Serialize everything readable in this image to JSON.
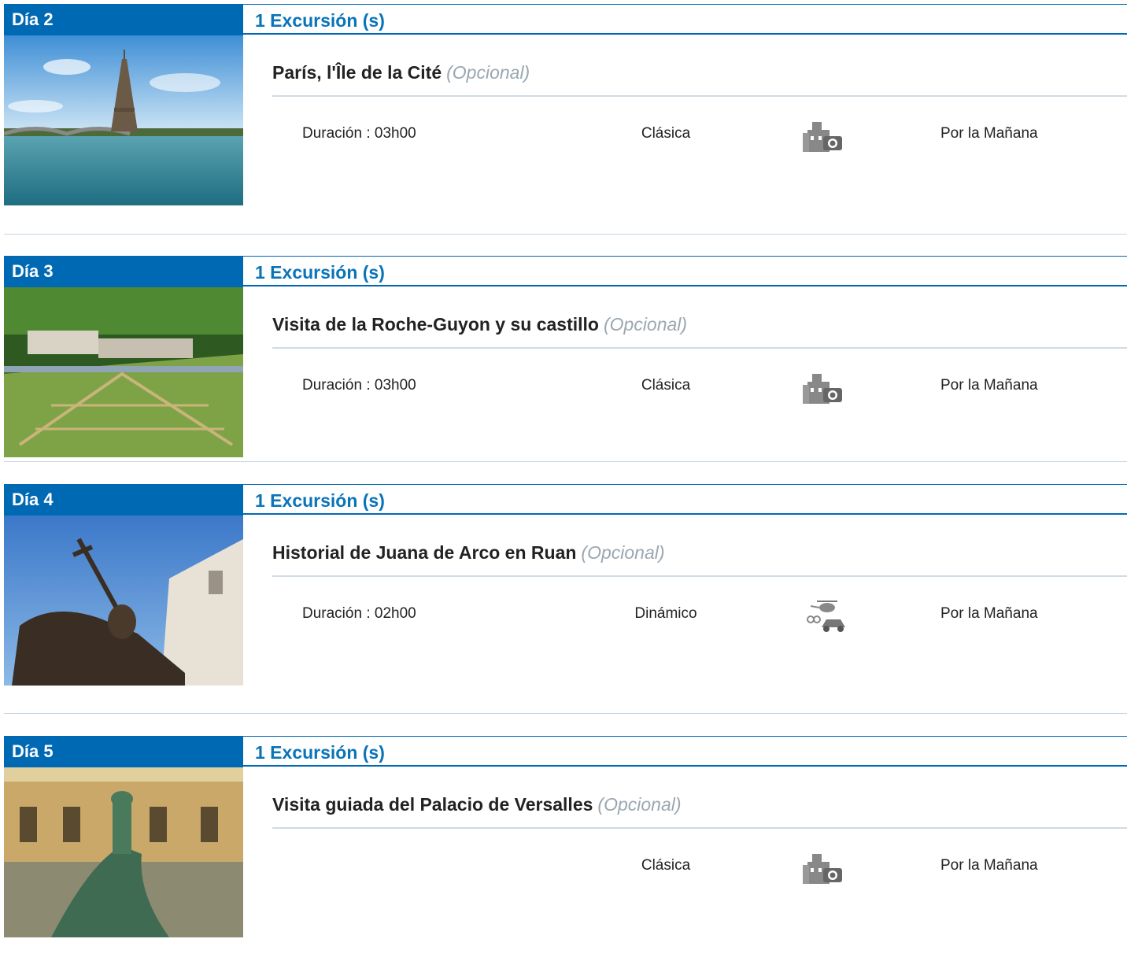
{
  "days": [
    {
      "day_label": "Día 2",
      "count_label": "1 Excursión (s)",
      "title": "París, l'Île de la Cité",
      "optional": "(Opcional)",
      "duration": "Duración : 03h00",
      "type": "Clásica",
      "icon": "castle-camera-icon",
      "time": "Por la Mañana",
      "photo": "eiffel-tower-photo"
    },
    {
      "day_label": "Día 3",
      "count_label": "1 Excursión (s)",
      "title": "Visita de la Roche-Guyon y su castillo",
      "optional": "(Opcional)",
      "duration": "Duración : 03h00",
      "type": "Clásica",
      "icon": "castle-camera-icon",
      "time": "Por la Mañana",
      "photo": "roche-guyon-photo"
    },
    {
      "day_label": "Día 4",
      "count_label": "1 Excursión (s)",
      "title": "Historial de Juana de Arco en Ruan",
      "optional": "(Opcional)",
      "duration": "Duración : 02h00",
      "type": "Dinámico",
      "icon": "helicopter-car-icon",
      "time": "Por la Mañana",
      "photo": "joan-of-arc-statue-photo"
    },
    {
      "day_label": "Día 5",
      "count_label": "1 Excursión (s)",
      "title": "Visita guiada del Palacio de Versalles",
      "optional": "(Opcional)",
      "duration": "",
      "type": "Clásica",
      "icon": "castle-camera-icon",
      "time": "Por la Mañana",
      "photo": "versailles-fountain-photo"
    }
  ],
  "colors": {
    "header_blue": "#0069b4",
    "title_blue": "#0a74b9",
    "optional_gray": "#9aa7b1",
    "separator": "#c7d6e3"
  }
}
